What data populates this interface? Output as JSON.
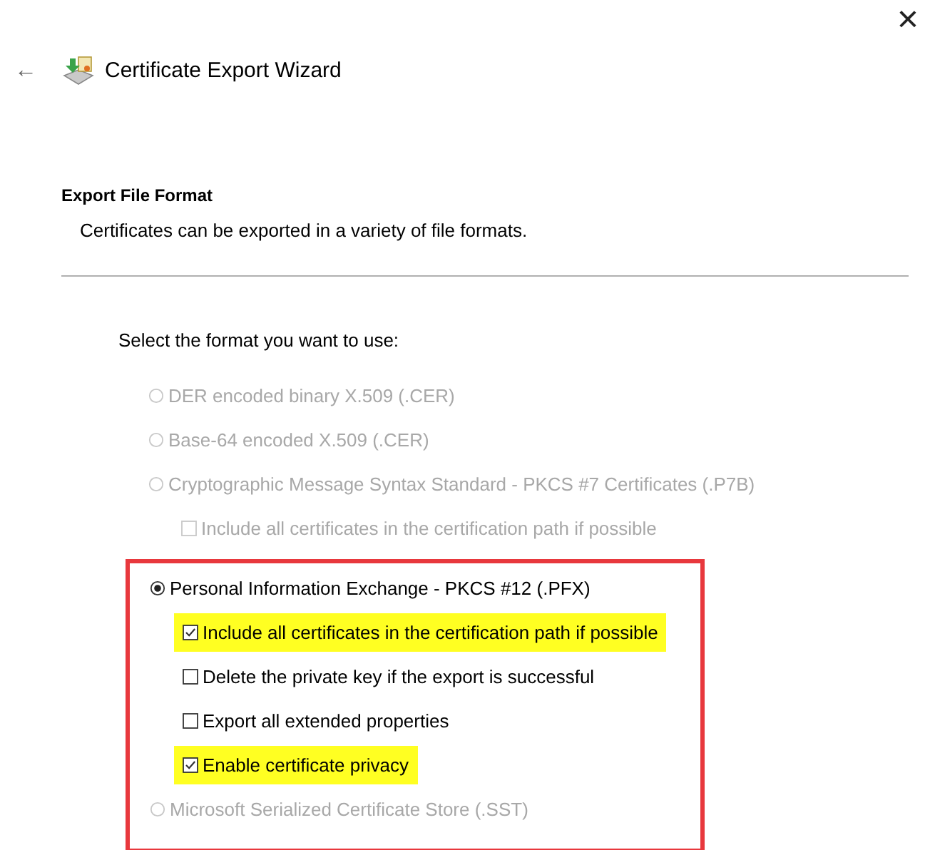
{
  "window": {
    "title": "Certificate Export Wizard",
    "back": "←",
    "close": "×"
  },
  "section": {
    "title": "Export File Format",
    "description": "Certificates can be exported in a variety of file formats."
  },
  "prompt": "Select the format you want to use:",
  "options": [
    {
      "kind": "radio",
      "label": "DER encoded binary X.509 (.CER)",
      "selected": false,
      "disabled": true,
      "highlighted": false
    },
    {
      "kind": "radio",
      "label": "Base-64 encoded X.509 (.CER)",
      "selected": false,
      "disabled": true,
      "highlighted": false
    },
    {
      "kind": "radio",
      "label": "Cryptographic Message Syntax Standard - PKCS #7 Certificates (.P7B)",
      "selected": false,
      "disabled": true,
      "highlighted": false,
      "children": [
        {
          "kind": "checkbox",
          "label": "Include all certificates in the certification path if possible",
          "checked": false,
          "disabled": true,
          "highlighted": false
        }
      ]
    }
  ],
  "callout": {
    "options": [
      {
        "kind": "radio",
        "label": "Personal Information Exchange - PKCS #12 (.PFX)",
        "selected": true,
        "disabled": false,
        "highlighted": false,
        "children": [
          {
            "kind": "checkbox",
            "label": "Include all certificates in the certification path if possible",
            "checked": true,
            "disabled": false,
            "highlighted": true
          },
          {
            "kind": "checkbox",
            "label": "Delete the private key if the export is successful",
            "checked": false,
            "disabled": false,
            "highlighted": false
          },
          {
            "kind": "checkbox",
            "label": "Export all extended properties",
            "checked": false,
            "disabled": false,
            "highlighted": false
          },
          {
            "kind": "checkbox",
            "label": "Enable certificate privacy",
            "checked": true,
            "disabled": false,
            "highlighted": true
          }
        ]
      },
      {
        "kind": "radio",
        "label": "Microsoft Serialized Certificate Store (.SST)",
        "selected": false,
        "disabled": true,
        "highlighted": false
      }
    ]
  }
}
